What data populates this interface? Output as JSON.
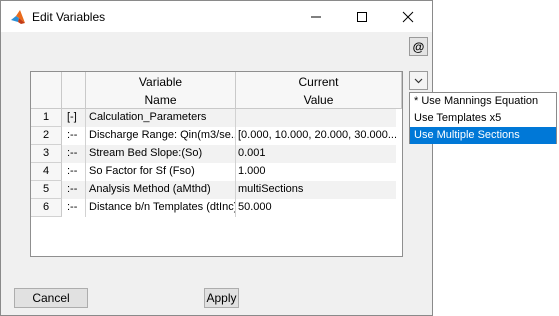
{
  "window": {
    "title": "Edit Variables"
  },
  "icons": {
    "app": "matlab-icon",
    "minimize": "minimize-icon",
    "maximize": "maximize-icon",
    "close": "close-icon",
    "dropdown": "chevron-down-icon"
  },
  "toolbar": {
    "at_label": "@"
  },
  "table": {
    "headers": {
      "variable": [
        "Variable",
        "Name"
      ],
      "value": [
        "Current",
        "Value"
      ]
    },
    "rows": [
      {
        "num": "1",
        "tree": "[-]",
        "name": "Calculation_Parameters",
        "value": ""
      },
      {
        "num": "2",
        "tree": ":--",
        "name": "Discharge Range: Qin(m3/se...",
        "value": "[0.000, 10.000, 20.000, 30.000..."
      },
      {
        "num": "3",
        "tree": ":--",
        "name": "Stream Bed Slope:(So)",
        "value": "0.001"
      },
      {
        "num": "4",
        "tree": ":--",
        "name": "So Factor for Sf (Fso)",
        "value": "1.000"
      },
      {
        "num": "5",
        "tree": ":--",
        "name": "Analysis Method (aMthd)",
        "value": "multiSections"
      },
      {
        "num": "6",
        "tree": ":--",
        "name": "Distance b/n Templates (dtInc)",
        "value": "50.000"
      }
    ]
  },
  "dropdown_menu": {
    "options": [
      "* Use Mannings Equation",
      "Use Templates x5",
      "Use Multiple Sections"
    ],
    "selected": "Use Multiple Sections"
  },
  "buttons": {
    "cancel": "Cancel",
    "apply": "Apply"
  },
  "colors": {
    "selection": "#0078d7",
    "window_bg": "#f0f0f0"
  }
}
